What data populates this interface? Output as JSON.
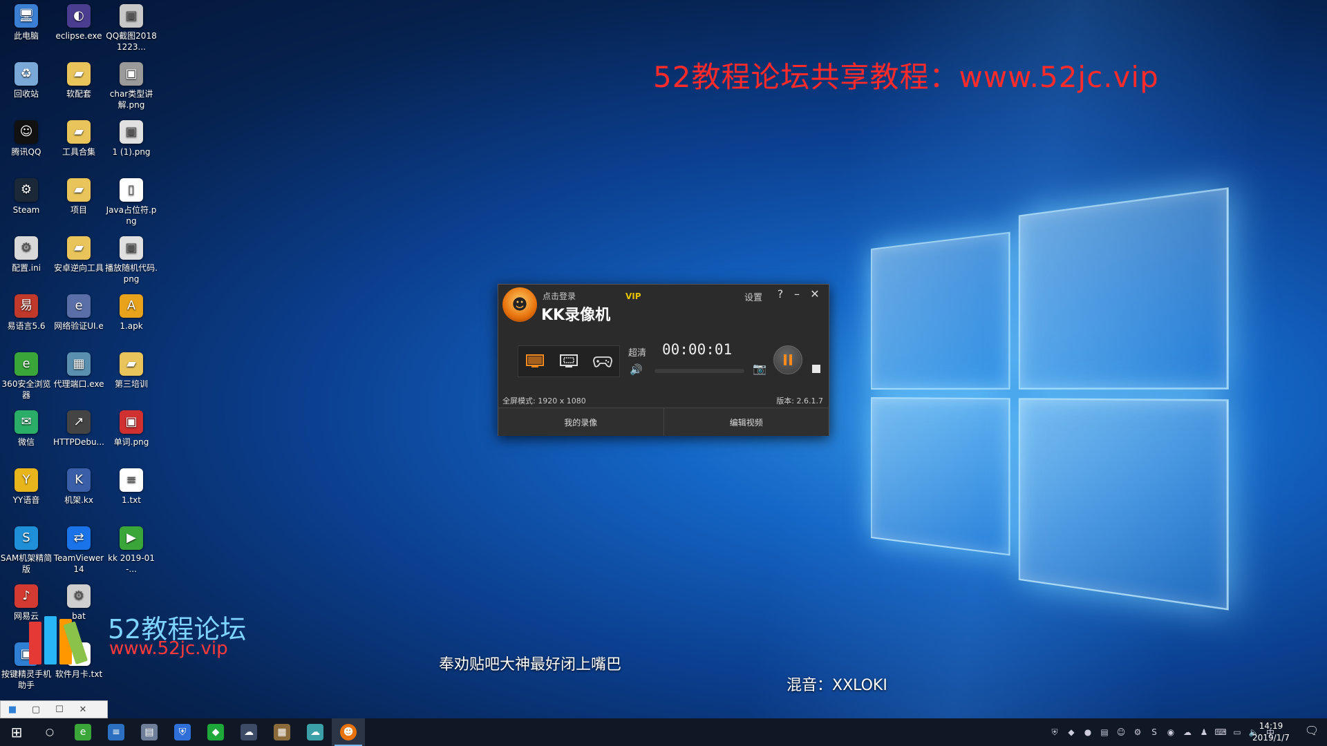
{
  "watermark": {
    "top_text": "52教程论坛共享教程：www.52jc.vip",
    "logo_text": "52教程论坛",
    "logo_url": "www.52jc.vip"
  },
  "subtitle": "奉劝贴吧大神最好闭上嘴巴",
  "mix_credit": "混音：XXLOKI",
  "desktop_icons": [
    {
      "label": "此电脑",
      "icon": "computer-icon",
      "color": "#3b7fd4"
    },
    {
      "label": "eclipse.exe",
      "icon": "eclipse-icon",
      "color": "#4a3d8f"
    },
    {
      "label": "QQ截图20181223...",
      "icon": "image-file-icon",
      "color": "#c8c8c8"
    },
    {
      "label": "回收站",
      "icon": "recycle-bin-icon",
      "color": "#7aa9d8"
    },
    {
      "label": "软配套",
      "icon": "folder-icon",
      "color": "#e8c45a"
    },
    {
      "label": "char类型讲解.png",
      "icon": "image-file-icon",
      "color": "#9a9a9a"
    },
    {
      "label": "腾讯QQ",
      "icon": "qq-icon",
      "color": "#111111"
    },
    {
      "label": "工具合集",
      "icon": "folder-icon",
      "color": "#e8c45a"
    },
    {
      "label": "1 (1).png",
      "icon": "image-file-icon",
      "color": "#e0e0e0"
    },
    {
      "label": "Steam",
      "icon": "steam-icon",
      "color": "#1b2838"
    },
    {
      "label": "项目",
      "icon": "folder-icon",
      "color": "#e8c45a"
    },
    {
      "label": "Java占位符.png",
      "icon": "blank-file-icon",
      "color": "#ffffff"
    },
    {
      "label": "配置.ini",
      "icon": "config-file-icon",
      "color": "#d8d8d8"
    },
    {
      "label": "安卓逆向工具",
      "icon": "folder-icon",
      "color": "#e8c45a"
    },
    {
      "label": "播放随机代码.png",
      "icon": "image-file-icon",
      "color": "#e0e0e0"
    },
    {
      "label": "易语言5.6",
      "icon": "eyuyan-icon",
      "color": "#c0392b"
    },
    {
      "label": "网络验证UI.e",
      "icon": "e-file-icon",
      "color": "#5a6fa8"
    },
    {
      "label": "1.apk",
      "icon": "apk-icon",
      "color": "#e8a21c"
    },
    {
      "label": "360安全浏览器",
      "icon": "browser-360-icon",
      "color": "#3aa63a"
    },
    {
      "label": "代理端口.exe",
      "icon": "exe-icon",
      "color": "#5a8fb0"
    },
    {
      "label": "第三培训",
      "icon": "folder-icon",
      "color": "#e8c45a"
    },
    {
      "label": "微信",
      "icon": "wechat-icon",
      "color": "#2aae67"
    },
    {
      "label": "HTTPDebu...",
      "icon": "httpdebugger-icon",
      "color": "#444444"
    },
    {
      "label": "单词.png",
      "icon": "image-file-icon",
      "color": "#d03030"
    },
    {
      "label": "YY语音",
      "icon": "yy-icon",
      "color": "#e8b51c"
    },
    {
      "label": "机架.kx",
      "icon": "kx-file-icon",
      "color": "#3a5fa8"
    },
    {
      "label": "1.txt",
      "icon": "text-file-icon",
      "color": "#ffffff"
    },
    {
      "label": "SAM机架精简版",
      "icon": "sam-icon",
      "color": "#1f8fd8"
    },
    {
      "label": "TeamViewer 14",
      "icon": "teamviewer-icon",
      "color": "#1a73e8"
    },
    {
      "label": "kk 2019-01-...",
      "icon": "video-file-icon",
      "color": "#3aa63a"
    },
    {
      "label": "网易云",
      "icon": "netease-music-icon",
      "color": "#d33a31"
    },
    {
      "label": "bat",
      "icon": "bat-file-icon",
      "color": "#cfcfcf"
    },
    {
      "label": "",
      "icon": "blank-slot",
      "color": "transparent"
    },
    {
      "label": "按键精灵手机助手",
      "icon": "anjian-icon",
      "color": "#2f7fd4"
    },
    {
      "label": "软件月卡.txt",
      "icon": "text-file-icon",
      "color": "#ffffff"
    },
    {
      "label": "",
      "icon": "blank-slot",
      "color": "transparent"
    }
  ],
  "recorder": {
    "login": "点击登录",
    "vip": "VIP",
    "app_name": "KK录像机",
    "settings": "设置",
    "help": "?",
    "minimize": "–",
    "close": "✕",
    "quality": "超清",
    "timer": "00:00:01",
    "mode_text": "全屏模式: 1920 x 1080",
    "version": "版本: 2.6.1.7",
    "my_recordings": "我的录像",
    "edit_video": "编辑视频"
  },
  "mini_window": {
    "restore": "▢",
    "maximize": "☐",
    "close": "✕"
  },
  "taskbar": {
    "apps": [
      {
        "icon": "windows-start-icon",
        "color": "#101826"
      },
      {
        "icon": "cortana-icon",
        "color": "#101826"
      },
      {
        "icon": "browser-360-icon",
        "color": "#3aa63a"
      },
      {
        "icon": "notepad-icon",
        "color": "#2a6fc0"
      },
      {
        "icon": "file-explorer-icon",
        "color": "#6f7f99"
      },
      {
        "icon": "security-shield-icon",
        "color": "#2f6fd8"
      },
      {
        "icon": "green-diamond-icon",
        "color": "#1fa83a"
      },
      {
        "icon": "weather-icon",
        "color": "#3d4b66"
      },
      {
        "icon": "image-viewer-icon",
        "color": "#8a6a3a"
      },
      {
        "icon": "cloud-icon",
        "color": "#3ba0a8"
      },
      {
        "icon": "kk-recorder-icon",
        "color": "#e8720c"
      }
    ],
    "clock_time": "14:19",
    "clock_date": "2019/1/7",
    "ime": "中"
  }
}
